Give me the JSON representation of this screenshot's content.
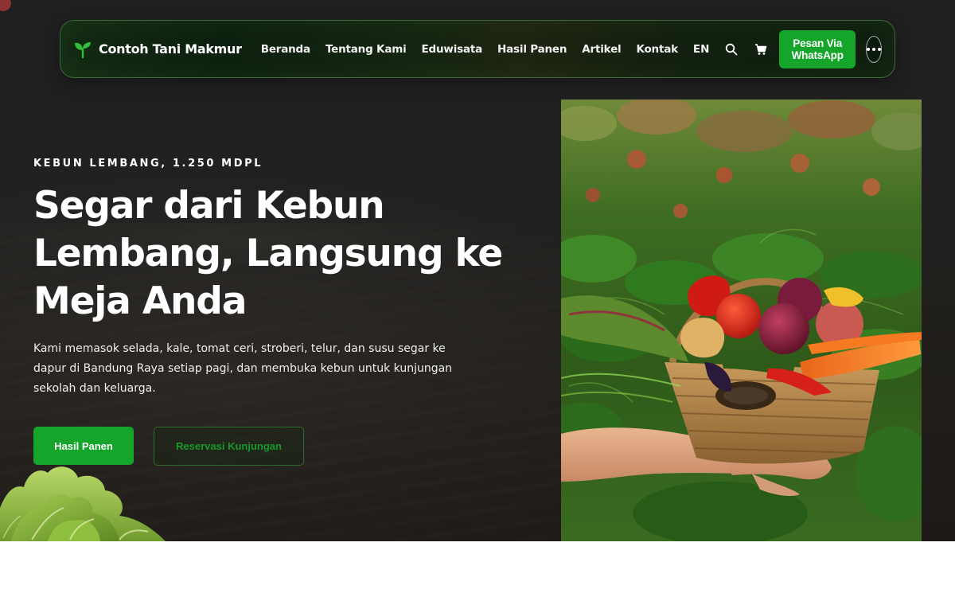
{
  "brand": {
    "name": "Contoh Tani Makmur",
    "icon": "sprout-icon"
  },
  "nav": {
    "links": [
      "Beranda",
      "Tentang Kami",
      "Eduwisata",
      "Hasil Panen",
      "Artikel",
      "Kontak"
    ],
    "language": "EN",
    "search_icon": "search-icon",
    "cart_icon": "cart-icon",
    "whatsapp_label": "Pesan Via WhatsApp",
    "more_icon": "more-dots-icon"
  },
  "hero": {
    "eyebrow": "KEBUN LEMBANG, 1.250 MDPL",
    "headline": "Segar dari Kebun Lembang, Langsung ke Meja Anda",
    "lede": "Kami memasok selada, kale, tomat ceri, stroberi, telur, dan susu segar ke dapur di Bandung Raya setiap pagi, dan membuka kebun untuk kunjungan sekolah dan keluarga.",
    "primary_cta": "Hasil Panen",
    "secondary_cta": "Reservasi Kunjungan"
  },
  "colors": {
    "accent_green": "#15a52a",
    "hero_background": "#2a2a2a",
    "nav_background": "#12200f"
  }
}
